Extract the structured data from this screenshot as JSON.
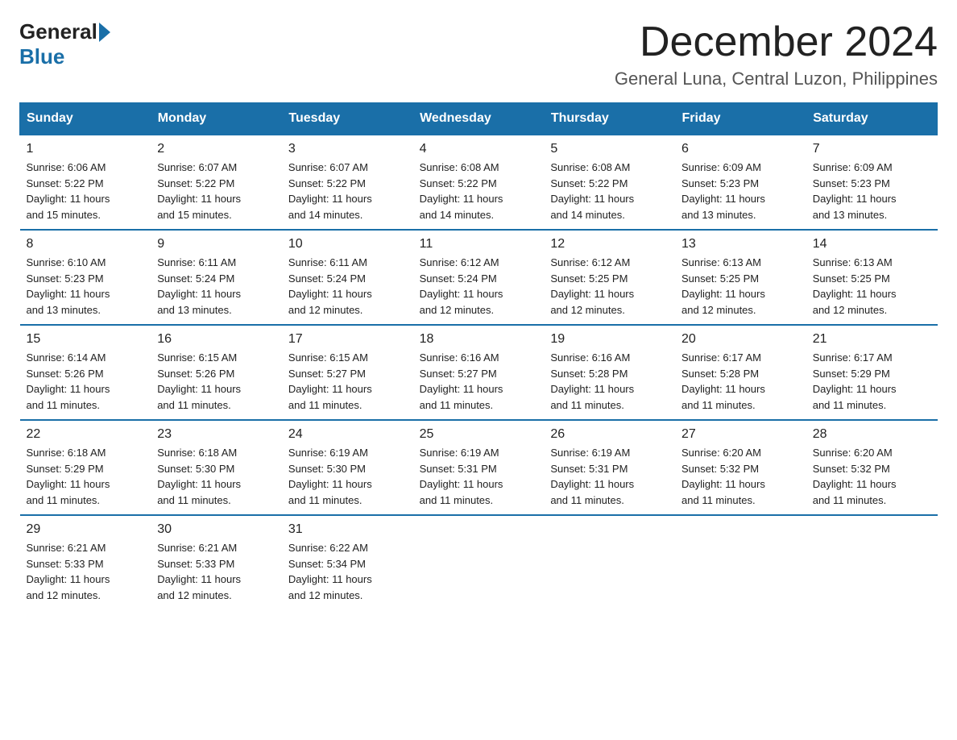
{
  "logo": {
    "general": "General",
    "blue": "Blue"
  },
  "title": "December 2024",
  "location": "General Luna, Central Luzon, Philippines",
  "days_of_week": [
    "Sunday",
    "Monday",
    "Tuesday",
    "Wednesday",
    "Thursday",
    "Friday",
    "Saturday"
  ],
  "weeks": [
    [
      {
        "day": "1",
        "sunrise": "6:06 AM",
        "sunset": "5:22 PM",
        "daylight": "11 hours and 15 minutes."
      },
      {
        "day": "2",
        "sunrise": "6:07 AM",
        "sunset": "5:22 PM",
        "daylight": "11 hours and 15 minutes."
      },
      {
        "day": "3",
        "sunrise": "6:07 AM",
        "sunset": "5:22 PM",
        "daylight": "11 hours and 14 minutes."
      },
      {
        "day": "4",
        "sunrise": "6:08 AM",
        "sunset": "5:22 PM",
        "daylight": "11 hours and 14 minutes."
      },
      {
        "day": "5",
        "sunrise": "6:08 AM",
        "sunset": "5:22 PM",
        "daylight": "11 hours and 14 minutes."
      },
      {
        "day": "6",
        "sunrise": "6:09 AM",
        "sunset": "5:23 PM",
        "daylight": "11 hours and 13 minutes."
      },
      {
        "day": "7",
        "sunrise": "6:09 AM",
        "sunset": "5:23 PM",
        "daylight": "11 hours and 13 minutes."
      }
    ],
    [
      {
        "day": "8",
        "sunrise": "6:10 AM",
        "sunset": "5:23 PM",
        "daylight": "11 hours and 13 minutes."
      },
      {
        "day": "9",
        "sunrise": "6:11 AM",
        "sunset": "5:24 PM",
        "daylight": "11 hours and 13 minutes."
      },
      {
        "day": "10",
        "sunrise": "6:11 AM",
        "sunset": "5:24 PM",
        "daylight": "11 hours and 12 minutes."
      },
      {
        "day": "11",
        "sunrise": "6:12 AM",
        "sunset": "5:24 PM",
        "daylight": "11 hours and 12 minutes."
      },
      {
        "day": "12",
        "sunrise": "6:12 AM",
        "sunset": "5:25 PM",
        "daylight": "11 hours and 12 minutes."
      },
      {
        "day": "13",
        "sunrise": "6:13 AM",
        "sunset": "5:25 PM",
        "daylight": "11 hours and 12 minutes."
      },
      {
        "day": "14",
        "sunrise": "6:13 AM",
        "sunset": "5:25 PM",
        "daylight": "11 hours and 12 minutes."
      }
    ],
    [
      {
        "day": "15",
        "sunrise": "6:14 AM",
        "sunset": "5:26 PM",
        "daylight": "11 hours and 11 minutes."
      },
      {
        "day": "16",
        "sunrise": "6:15 AM",
        "sunset": "5:26 PM",
        "daylight": "11 hours and 11 minutes."
      },
      {
        "day": "17",
        "sunrise": "6:15 AM",
        "sunset": "5:27 PM",
        "daylight": "11 hours and 11 minutes."
      },
      {
        "day": "18",
        "sunrise": "6:16 AM",
        "sunset": "5:27 PM",
        "daylight": "11 hours and 11 minutes."
      },
      {
        "day": "19",
        "sunrise": "6:16 AM",
        "sunset": "5:28 PM",
        "daylight": "11 hours and 11 minutes."
      },
      {
        "day": "20",
        "sunrise": "6:17 AM",
        "sunset": "5:28 PM",
        "daylight": "11 hours and 11 minutes."
      },
      {
        "day": "21",
        "sunrise": "6:17 AM",
        "sunset": "5:29 PM",
        "daylight": "11 hours and 11 minutes."
      }
    ],
    [
      {
        "day": "22",
        "sunrise": "6:18 AM",
        "sunset": "5:29 PM",
        "daylight": "11 hours and 11 minutes."
      },
      {
        "day": "23",
        "sunrise": "6:18 AM",
        "sunset": "5:30 PM",
        "daylight": "11 hours and 11 minutes."
      },
      {
        "day": "24",
        "sunrise": "6:19 AM",
        "sunset": "5:30 PM",
        "daylight": "11 hours and 11 minutes."
      },
      {
        "day": "25",
        "sunrise": "6:19 AM",
        "sunset": "5:31 PM",
        "daylight": "11 hours and 11 minutes."
      },
      {
        "day": "26",
        "sunrise": "6:19 AM",
        "sunset": "5:31 PM",
        "daylight": "11 hours and 11 minutes."
      },
      {
        "day": "27",
        "sunrise": "6:20 AM",
        "sunset": "5:32 PM",
        "daylight": "11 hours and 11 minutes."
      },
      {
        "day": "28",
        "sunrise": "6:20 AM",
        "sunset": "5:32 PM",
        "daylight": "11 hours and 11 minutes."
      }
    ],
    [
      {
        "day": "29",
        "sunrise": "6:21 AM",
        "sunset": "5:33 PM",
        "daylight": "11 hours and 12 minutes."
      },
      {
        "day": "30",
        "sunrise": "6:21 AM",
        "sunset": "5:33 PM",
        "daylight": "11 hours and 12 minutes."
      },
      {
        "day": "31",
        "sunrise": "6:22 AM",
        "sunset": "5:34 PM",
        "daylight": "11 hours and 12 minutes."
      },
      null,
      null,
      null,
      null
    ]
  ],
  "labels": {
    "sunrise": "Sunrise:",
    "sunset": "Sunset:",
    "daylight": "Daylight:"
  }
}
